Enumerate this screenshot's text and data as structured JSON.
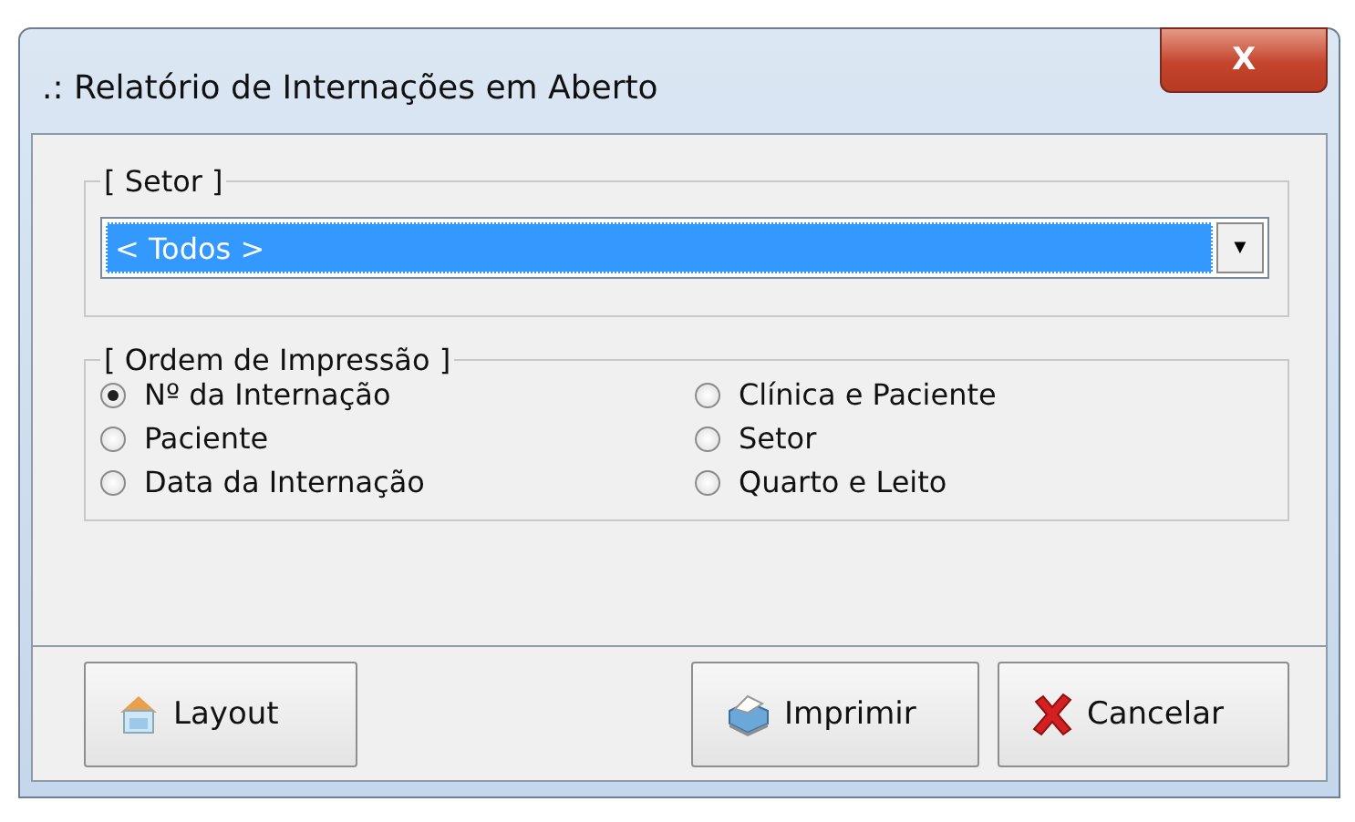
{
  "window": {
    "title": ".: Relatório de Internações em Aberto",
    "close": "X"
  },
  "setor": {
    "legend": "[ Setor ]",
    "value": "< Todos >",
    "selected": true,
    "arrow": "▼"
  },
  "ordem": {
    "legend": "[ Ordem de Impressão ]",
    "options": [
      {
        "label": "Nº da Internação",
        "selected": true
      },
      {
        "label": "Clínica e Paciente",
        "selected": false
      },
      {
        "label": "Paciente",
        "selected": false
      },
      {
        "label": "Setor",
        "selected": false
      },
      {
        "label": "Data da Internação",
        "selected": false
      },
      {
        "label": "Quarto e Leito",
        "selected": false
      }
    ]
  },
  "buttons": [
    {
      "kind": "layout",
      "label": "Layout"
    },
    {
      "kind": "print",
      "label": "Imprimir"
    },
    {
      "kind": "cancel",
      "label": "Cancelar"
    }
  ]
}
